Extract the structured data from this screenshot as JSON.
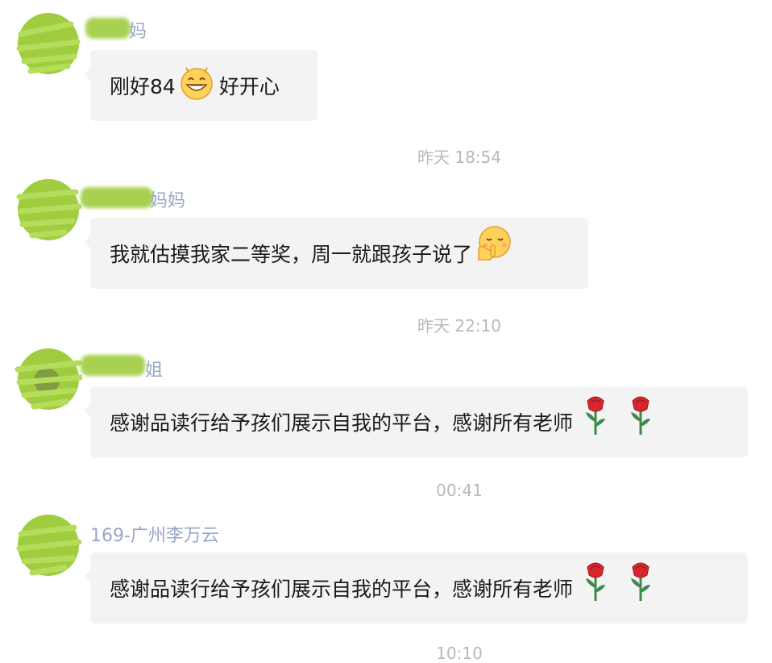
{
  "messages": [
    {
      "sender": "妈",
      "parts": [
        "刚好84",
        "好开心"
      ],
      "emoji": [
        "grin-emoji"
      ]
    },
    {
      "sender": "妈妈",
      "parts": [
        "我就估摸我家二等奖，周一就跟孩子说了"
      ],
      "emoji": [
        "shush-emoji"
      ]
    },
    {
      "sender": "姐",
      "parts": [
        "感谢品读行给予孩们展示自我的平台，感谢所有老师"
      ],
      "emoji": [
        "rose-emoji",
        "rose-emoji"
      ]
    },
    {
      "sender": "169-广州李万云",
      "parts": [
        "感谢品读行给予孩们展示自我的平台，感谢所有老师"
      ],
      "emoji": [
        "rose-emoji",
        "rose-emoji"
      ]
    }
  ],
  "timestamps": [
    "昨天  18:54",
    "昨天  22:10",
    "00:41",
    "10:10"
  ],
  "colors": {
    "bubble": "#f3f3f3",
    "sender_name": "#9aa6c6",
    "timestamp": "#b8b8b8",
    "avatar_scribble": "#9fcd3f"
  }
}
